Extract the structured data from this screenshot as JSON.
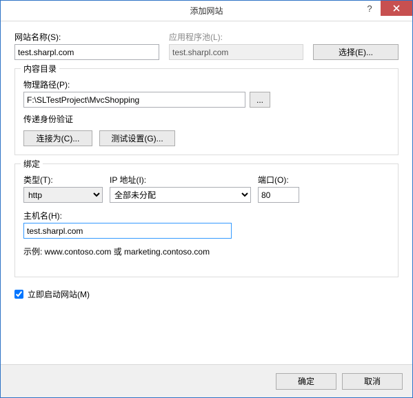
{
  "title": "添加网站",
  "labels": {
    "site_name": "网站名称(S):",
    "app_pool": "应用程序池(L):",
    "select_btn": "选择(E)...",
    "content_dir": "内容目录",
    "physical_path": "物理路径(P):",
    "browse": "...",
    "pass_auth": "传递身份验证",
    "connect_as": "连接为(C)...",
    "test_settings": "测试设置(G)...",
    "binding": "绑定",
    "type": "类型(T):",
    "ip": "IP 地址(I):",
    "port": "端口(O):",
    "hostname": "主机名(H):",
    "example": "示例: www.contoso.com 或 marketing.contoso.com",
    "start_site": "立即启动网站(M)",
    "ok": "确定",
    "cancel": "取消"
  },
  "values": {
    "site_name": "test.sharpl.com",
    "app_pool": "test.sharpl.com",
    "physical_path": "F:\\SLTestProject\\MvcShopping",
    "type": "http",
    "ip": "全部未分配",
    "port": "80",
    "hostname": "test.sharpl.com",
    "start_site_checked": true
  }
}
